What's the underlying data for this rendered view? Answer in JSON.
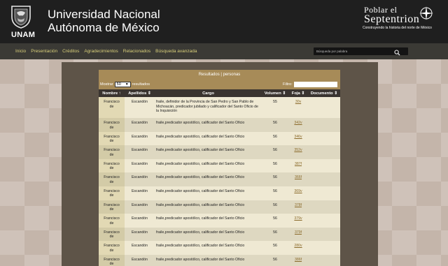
{
  "header": {
    "logo_word": "UNAM",
    "university_line1": "Universidad Nacional",
    "university_line2": "Autónoma de México",
    "brand_line1": "Poblar el",
    "brand_line2": "Septentrion",
    "brand_tagline": "Construyendo la historia del norte de México",
    "icons": [
      "unam-shield-icon",
      "compass-icon"
    ]
  },
  "nav": {
    "items": [
      "Inicio",
      "Presentación",
      "Créditos",
      "Agradecimientos",
      "Relacionados",
      "Búsqueda avanzada"
    ],
    "search_placeholder": "Búsqueda por palabra",
    "search_icon": "search-icon"
  },
  "results": {
    "title": "Resultados | personas",
    "show_label": "Mostrar",
    "show_value": "50",
    "show_suffix": "resultados",
    "filter_label": "Filtro:",
    "filter_value": "",
    "columns": [
      "Nombre ↑",
      "Apellidos ⇕",
      "Cargo",
      "Volumen ⇕",
      "Foja ⇕",
      "Documento ⇕"
    ],
    "rows": [
      {
        "nombre1": "Francisco",
        "nombre2": "de",
        "apellidos": "Escandón",
        "cargo": "fraile, definidor de la Provincia de San Pedro y San Pablo de Michoacán, predicador jubilado y calificador del Santo Oficio de la Inquisición",
        "volumen": "55",
        "foja": "30v",
        "documento": ""
      },
      {
        "nombre1": "Francisco",
        "nombre2": "de",
        "apellidos": "Escandón",
        "cargo": "fraile,predicador apostólico, calificador del Santo Oficio",
        "volumen": "56",
        "foja": "342v",
        "documento": ""
      },
      {
        "nombre1": "Francisco",
        "nombre2": "de",
        "apellidos": "Escandón",
        "cargo": "fraile,predicador apostólico, calificador del Santo Oficio",
        "volumen": "56",
        "foja": "346v",
        "documento": ""
      },
      {
        "nombre1": "Francisco",
        "nombre2": "de",
        "apellidos": "Escandón",
        "cargo": "fraile,predicador apostólico, calificador del Santo Oficio",
        "volumen": "56",
        "foja": "352v",
        "documento": ""
      },
      {
        "nombre1": "Francisco",
        "nombre2": "de",
        "apellidos": "Escandón",
        "cargo": "fraile,predicador apostólico, calificador del Santo Oficio",
        "volumen": "56",
        "foja": "387f",
        "documento": ""
      },
      {
        "nombre1": "Francisco",
        "nombre2": "de",
        "apellidos": "Escandón",
        "cargo": "fraile,predicador apostólico, calificador del Santo Oficio",
        "volumen": "56",
        "foja": "366f",
        "documento": ""
      },
      {
        "nombre1": "Francisco",
        "nombre2": "de",
        "apellidos": "Escandón",
        "cargo": "fraile,predicador apostólico, calificador del Santo Oficio",
        "volumen": "56",
        "foja": "369v",
        "documento": ""
      },
      {
        "nombre1": "Francisco",
        "nombre2": "de",
        "apellidos": "Escandón",
        "cargo": "fraile,predicador apostólico, calificador del Santo Oficio",
        "volumen": "56",
        "foja": "378f",
        "documento": ""
      },
      {
        "nombre1": "Francisco",
        "nombre2": "de",
        "apellidos": "Escandón",
        "cargo": "fraile,predicador apostólico, calificador del Santo Oficio",
        "volumen": "56",
        "foja": "379v",
        "documento": ""
      },
      {
        "nombre1": "Francisco",
        "nombre2": "de",
        "apellidos": "Escandón",
        "cargo": "fraile,predicador apostólico, calificador del Santo Oficio",
        "volumen": "56",
        "foja": "379f",
        "documento": ""
      },
      {
        "nombre1": "Francisco",
        "nombre2": "de",
        "apellidos": "Escandón",
        "cargo": "fraile,predicador apostólico, calificador del Santo Oficio",
        "volumen": "56",
        "foja": "280v",
        "documento": ""
      },
      {
        "nombre1": "Francisco",
        "nombre2": "de",
        "apellidos": "Escandón",
        "cargo": "fraile,predicador apostólico, calificador del Santo Oficio",
        "volumen": "56",
        "foja": "386f",
        "documento": ""
      }
    ]
  },
  "colors": {
    "header_bg": "#1f1f1f",
    "nav_bg": "#3b3a35",
    "nav_link": "#d8cf7a",
    "results_head_bg": "#a78b58",
    "table_head_bg": "#3a3430",
    "row_odd": "#efe9d3",
    "row_even": "#ded8c1",
    "foja_link": "#8a6a2a"
  }
}
